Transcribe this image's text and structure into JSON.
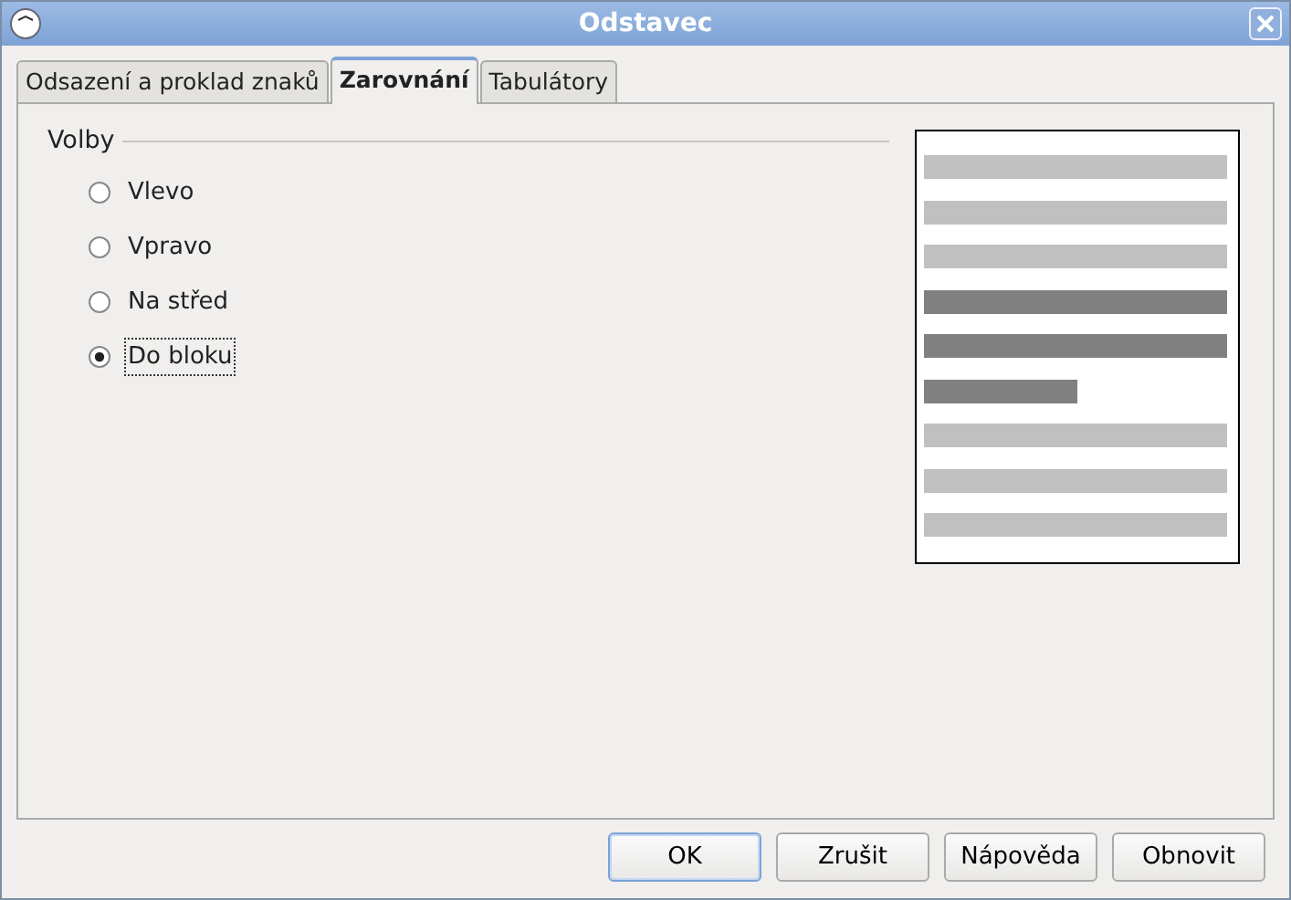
{
  "window": {
    "title": "Odstavec"
  },
  "tabs": [
    {
      "label": "Odsazení a proklad znaků",
      "selected": false
    },
    {
      "label": "Zarovnání",
      "selected": true
    },
    {
      "label": "Tabulátory",
      "selected": false
    }
  ],
  "options": {
    "title": "Volby",
    "items": [
      {
        "label": "Vlevo",
        "selected": false
      },
      {
        "label": "Vpravo",
        "selected": false
      },
      {
        "label": "Na střed",
        "selected": false
      },
      {
        "label": "Do bloku",
        "selected": true
      }
    ]
  },
  "buttons": [
    {
      "label": "OK",
      "default": true
    },
    {
      "label": "Zrušit",
      "default": false
    },
    {
      "label": "Nápověda",
      "default": false
    },
    {
      "label": "Obnovit",
      "default": false
    }
  ]
}
